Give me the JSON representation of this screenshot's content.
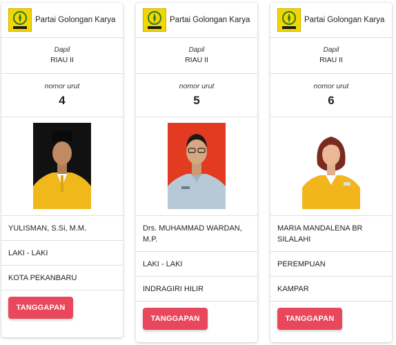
{
  "candidates": [
    {
      "party_name": "Partai Golongan Karya",
      "dapil_label": "Dapil",
      "dapil_value": "RIAU II",
      "nomor_label": "nomor urut",
      "nomor_value": "4",
      "name": "YULISMAN, S.Si, M.M.",
      "gender": "LAKI - LAKI",
      "region": "KOTA PEKANBARU",
      "button_label": "TANGGAPAN",
      "photo_bg": "#111111",
      "shirt_color": "#f0b81a"
    },
    {
      "party_name": "Partai Golongan Karya",
      "dapil_label": "Dapil",
      "dapil_value": "RIAU II",
      "nomor_label": "nomor urut",
      "nomor_value": "5",
      "name": "Drs. MUHAMMAD WARDAN, M.P.",
      "gender": "LAKI - LAKI",
      "region": "INDRAGIRI HILIR",
      "button_label": "TANGGAPAN",
      "photo_bg": "#e33a22",
      "shirt_color": "#b7c9d6"
    },
    {
      "party_name": "Partai Golongan Karya",
      "dapil_label": "Dapil",
      "dapil_value": "RIAU II",
      "nomor_label": "nomor urut",
      "nomor_value": "6",
      "name": "MARIA MANDALENA BR SILALAHI",
      "gender": "PEREMPUAN",
      "region": "KAMPAR",
      "button_label": "TANGGAPAN",
      "photo_bg": "#ffffff",
      "shirt_color": "#f2b51c"
    }
  ],
  "colors": {
    "button": "#e8475c",
    "logo_yellow": "#f2d600"
  },
  "icons": [
    "golkar-logo-icon"
  ]
}
